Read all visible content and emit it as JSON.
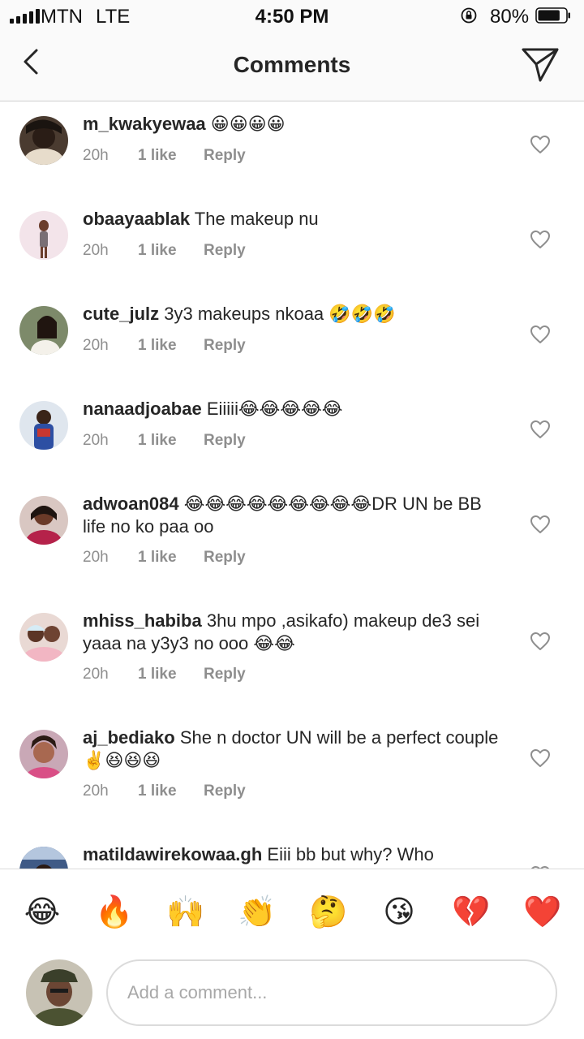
{
  "status_bar": {
    "carrier": "MTN",
    "network": "LTE",
    "time": "4:50 PM",
    "battery_percent": "80%",
    "battery_level": 0.8
  },
  "header": {
    "title": "Comments"
  },
  "comments": [
    {
      "username": "m_kwakyewaa",
      "text": "😀😀😀😀",
      "time": "20h",
      "likes": "1 like",
      "reply_label": "Reply"
    },
    {
      "username": "obaayaablak",
      "text": "The makeup nu",
      "time": "20h",
      "likes": "1 like",
      "reply_label": "Reply"
    },
    {
      "username": "cute_julz",
      "text": "3y3 makeups nkoaa 🤣🤣🤣",
      "time": "20h",
      "likes": "1 like",
      "reply_label": "Reply"
    },
    {
      "username": "nanaadjoabae",
      "text": "Eiiiii😂😂😂😂😂",
      "time": "20h",
      "likes": "1 like",
      "reply_label": "Reply"
    },
    {
      "username": "adwoan084",
      "text": "😂😂😂😂😂😂😂😂😂DR UN be BB life no ko paa oo",
      "time": "20h",
      "likes": "1 like",
      "reply_label": "Reply"
    },
    {
      "username": "mhiss_habiba",
      "text": "3hu mpo ,asikafo) makeup de3 sei yaaa na y3y3 no ooo 😂😂",
      "time": "20h",
      "likes": "1 like",
      "reply_label": "Reply"
    },
    {
      "username": "aj_bediako",
      "text": "She n doctor UN will be a perfect couple ✌️😆😆😆",
      "time": "20h",
      "likes": "1 like",
      "reply_label": "Reply"
    },
    {
      "username": "matildawirekowaa.gh",
      "text": "Eiii bb but why? Who",
      "time": "",
      "likes": "",
      "reply_label": ""
    }
  ],
  "emoji_bar": [
    "😂",
    "🔥",
    "🙌",
    "👏",
    "🤔",
    "😘",
    "💔",
    "❤️"
  ],
  "composer": {
    "placeholder": "Add a comment..."
  },
  "icons": {
    "back": "chevron-left-icon",
    "share": "paper-plane-icon",
    "like": "heart-outline-icon"
  },
  "colors": {
    "text": "#262626",
    "secondary_text": "#8e8e8e",
    "divider": "#dbdbdb"
  }
}
